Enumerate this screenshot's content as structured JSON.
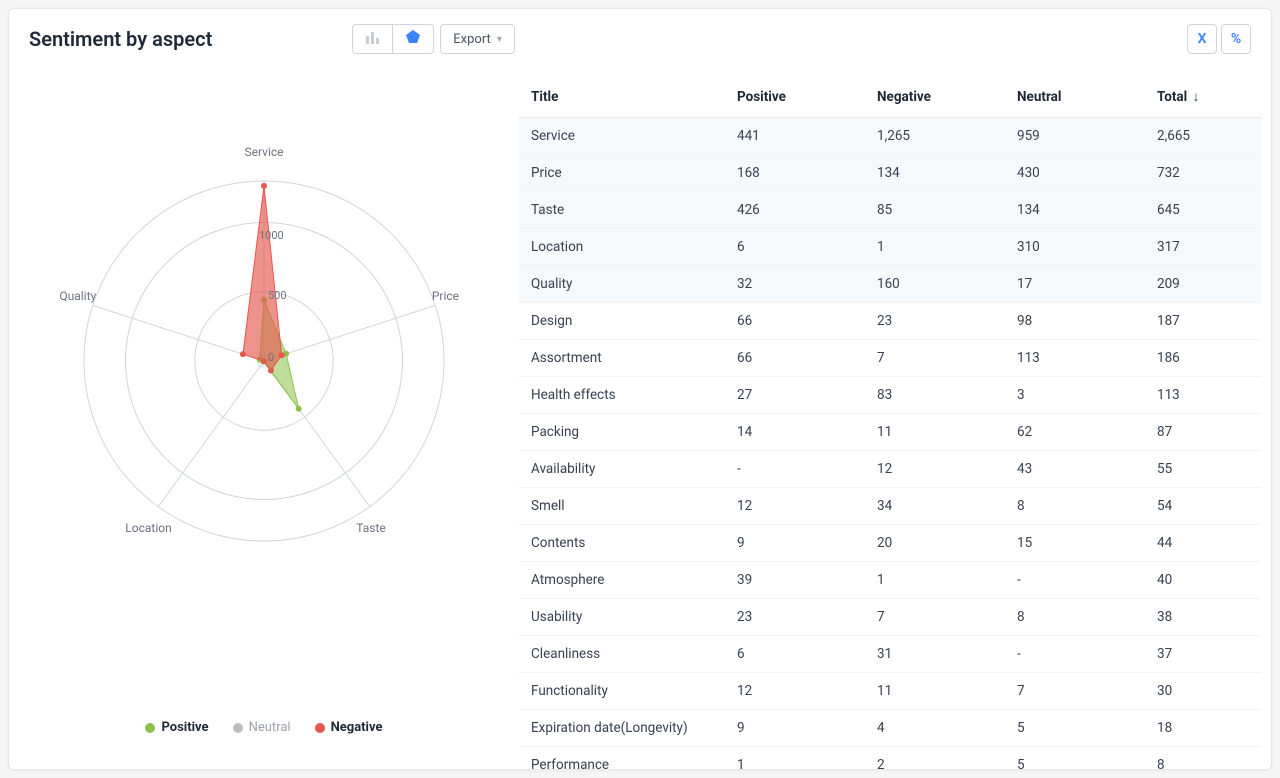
{
  "title": "Sentiment by aspect",
  "toolbar": {
    "export_label": "Export",
    "close_glyph": "X",
    "percent_glyph": "%"
  },
  "legend": {
    "positive": "Positive",
    "neutral": "Neutral",
    "negative": "Negative"
  },
  "columns": {
    "title": "Title",
    "positive": "Positive",
    "negative": "Negative",
    "neutral": "Neutral",
    "total": "Total",
    "sort_indicator": "↓"
  },
  "rows": [
    {
      "title": "Service",
      "positive": "441",
      "negative": "1,265",
      "neutral": "959",
      "total": "2,665"
    },
    {
      "title": "Price",
      "positive": "168",
      "negative": "134",
      "neutral": "430",
      "total": "732"
    },
    {
      "title": "Taste",
      "positive": "426",
      "negative": "85",
      "neutral": "134",
      "total": "645"
    },
    {
      "title": "Location",
      "positive": "6",
      "negative": "1",
      "neutral": "310",
      "total": "317"
    },
    {
      "title": "Quality",
      "positive": "32",
      "negative": "160",
      "neutral": "17",
      "total": "209"
    },
    {
      "title": "Design",
      "positive": "66",
      "negative": "23",
      "neutral": "98",
      "total": "187"
    },
    {
      "title": "Assortment",
      "positive": "66",
      "negative": "7",
      "neutral": "113",
      "total": "186"
    },
    {
      "title": "Health effects",
      "positive": "27",
      "negative": "83",
      "neutral": "3",
      "total": "113"
    },
    {
      "title": "Packing",
      "positive": "14",
      "negative": "11",
      "neutral": "62",
      "total": "87"
    },
    {
      "title": "Availability",
      "positive": "-",
      "negative": "12",
      "neutral": "43",
      "total": "55"
    },
    {
      "title": "Smell",
      "positive": "12",
      "negative": "34",
      "neutral": "8",
      "total": "54"
    },
    {
      "title": "Contents",
      "positive": "9",
      "negative": "20",
      "neutral": "15",
      "total": "44"
    },
    {
      "title": "Atmosphere",
      "positive": "39",
      "negative": "1",
      "neutral": "-",
      "total": "40"
    },
    {
      "title": "Usability",
      "positive": "23",
      "negative": "7",
      "neutral": "8",
      "total": "38"
    },
    {
      "title": "Cleanliness",
      "positive": "6",
      "negative": "31",
      "neutral": "-",
      "total": "37"
    },
    {
      "title": "Functionality",
      "positive": "12",
      "negative": "11",
      "neutral": "7",
      "total": "30"
    },
    {
      "title": "Expiration date(Longevity)",
      "positive": "9",
      "negative": "4",
      "neutral": "5",
      "total": "18"
    },
    {
      "title": "Performance",
      "positive": "1",
      "negative": "2",
      "neutral": "5",
      "total": "8"
    }
  ],
  "chart_data": {
    "type": "radar",
    "title": "Sentiment by aspect",
    "categories": [
      "Service",
      "Price",
      "Taste",
      "Location",
      "Quality"
    ],
    "radial_ticks": [
      0,
      500,
      1000
    ],
    "rmax": 1300,
    "series": [
      {
        "name": "Positive",
        "color": "#8bc34a",
        "values": [
          441,
          168,
          426,
          6,
          32
        ]
      },
      {
        "name": "Neutral",
        "color": "#bdbdbd",
        "values": [
          959,
          430,
          134,
          310,
          17
        ]
      },
      {
        "name": "Negative",
        "color": "#e5574f",
        "values": [
          1265,
          134,
          85,
          1,
          160
        ]
      }
    ]
  },
  "tick_labels": {
    "t0": "0",
    "t500": "500",
    "t1000": "1000"
  }
}
